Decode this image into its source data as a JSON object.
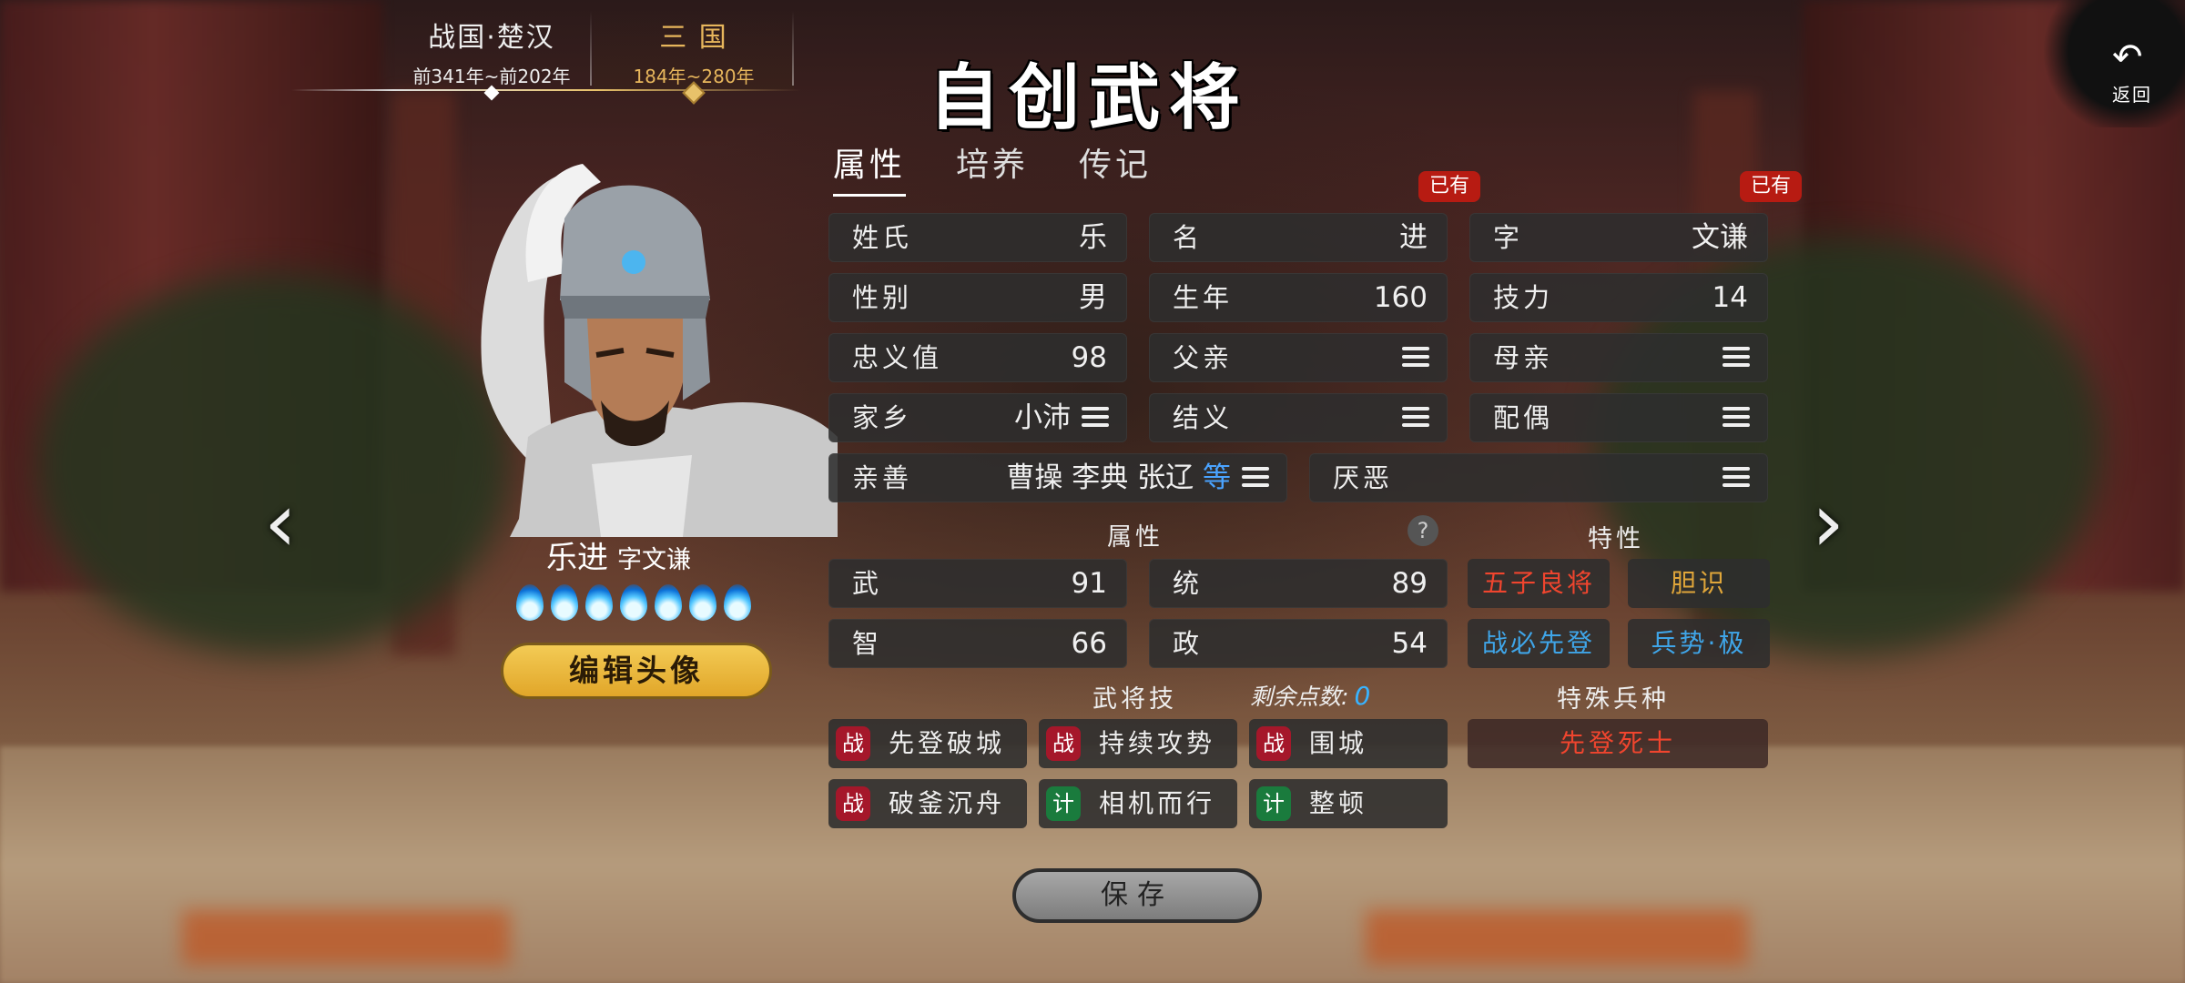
{
  "eras": [
    {
      "name": "战国·楚汉",
      "years": "前341年~前202年",
      "selected": false
    },
    {
      "name": "三 国",
      "years": "184年~280年",
      "selected": true
    }
  ],
  "page_title": "自创武将",
  "back_label": "返回",
  "hero": {
    "name": "乐进",
    "courtesy": "字文谦",
    "flame_count": 7
  },
  "edit_avatar_label": "编辑头像",
  "tabs": [
    {
      "label": "属性",
      "active": true
    },
    {
      "label": "培养",
      "active": false
    },
    {
      "label": "传记",
      "active": false
    }
  ],
  "badges": {
    "name_owned": "已有",
    "courtesy_owned": "已有"
  },
  "fields": {
    "surname": {
      "label": "姓氏",
      "value": "乐"
    },
    "given_name": {
      "label": "名",
      "value": "进"
    },
    "courtesy_name": {
      "label": "字",
      "value": "文谦"
    },
    "gender": {
      "label": "性别",
      "value": "男"
    },
    "birth_year": {
      "label": "生年",
      "value": "160"
    },
    "skill_power": {
      "label": "技力",
      "value": "14"
    },
    "loyalty": {
      "label": "忠义值",
      "value": "98"
    },
    "father": {
      "label": "父亲"
    },
    "mother": {
      "label": "母亲"
    },
    "hometown": {
      "label": "家乡",
      "value": "小沛"
    },
    "sworn": {
      "label": "结义"
    },
    "spouse": {
      "label": "配偶"
    },
    "friendly": {
      "label": "亲善",
      "value": "曹操 李典 张辽",
      "more": "等"
    },
    "dislike": {
      "label": "厌恶"
    }
  },
  "sections": {
    "attributes": "属性",
    "traits": "特性",
    "skills": "武将技",
    "remaining_label": "剩余点数:",
    "remaining_value": "0",
    "special_troop": "特殊兵种"
  },
  "help_icon": "?",
  "stats": [
    {
      "label": "武",
      "value": "91"
    },
    {
      "label": "统",
      "value": "89"
    },
    {
      "label": "智",
      "value": "66"
    },
    {
      "label": "政",
      "value": "54"
    }
  ],
  "traits": [
    {
      "label": "五子良将",
      "color": "#f0452e"
    },
    {
      "label": "胆识",
      "color": "#e0a63a"
    },
    {
      "label": "战必先登",
      "color": "#3fa5e8"
    },
    {
      "label": "兵势·极",
      "color": "#3fa5e8"
    }
  ],
  "skills": [
    {
      "type": "战",
      "name": "先登破城"
    },
    {
      "type": "战",
      "name": "持续攻势"
    },
    {
      "type": "战",
      "name": "围城"
    },
    {
      "type": "战",
      "name": "破釜沉舟"
    },
    {
      "type": "计",
      "name": "相机而行"
    },
    {
      "type": "计",
      "name": "整顿"
    }
  ],
  "special_troop_value": "先登死士",
  "save_label": "保存",
  "icons": {
    "back": "undo-arrow-icon",
    "menu": "hamburger-menu-icon",
    "prev": "chevron-left-icon",
    "next": "chevron-right-icon",
    "help": "question-icon"
  }
}
